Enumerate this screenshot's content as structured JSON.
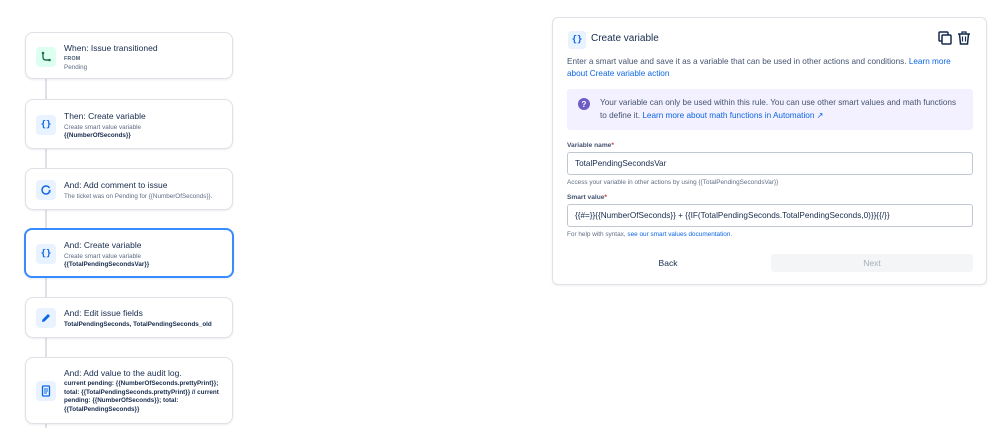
{
  "flow": {
    "cards": [
      {
        "title": "When: Issue transitioned",
        "sub_label": "FROM",
        "sub": "Pending",
        "icon": "branch-icon"
      },
      {
        "title": "Then: Create variable",
        "sub": "Create smart value variable",
        "detail": "{{NumberOfSeconds}}",
        "icon": "curly-braces-icon"
      },
      {
        "title": "And: Add comment to issue",
        "sub": "The ticket was on Pending for {{NumberOfSeconds}}.",
        "icon": "comment-arrow-icon"
      },
      {
        "title": "And: Create variable",
        "sub": "Create smart value variable",
        "detail": "{{TotalPendingSecondsVar}}",
        "icon": "curly-braces-icon"
      },
      {
        "title": "And: Edit issue fields",
        "detail": "TotalPendingSeconds, TotalPendingSeconds_old",
        "icon": "pencil-icon"
      },
      {
        "title": "And: Add value to the audit log.",
        "detail": "current pending: {{NumberOfSeconds.prettyPrint}}; total: {{TotalPendingSeconds.prettyPrint}} // current pending: {{NumberOfSeconds}}; total: {{TotalPendingSeconds}}",
        "icon": "document-icon"
      }
    ]
  },
  "panel": {
    "icon_glyph": "{}",
    "title": "Create variable",
    "description": "Enter a smart value and save it as a variable that can be used in other actions and conditions. ",
    "description_link": "Learn more about Create variable action",
    "info_text": "Your variable can only be used within this rule. You can use other smart values and math functions to define it. ",
    "info_link": "Learn more about math functions in Automation ↗",
    "info_icon_glyph": "?",
    "variable_name_label": "Variable name",
    "variable_name_value": "TotalPendingSecondsVar",
    "variable_name_helper": "Access your variable in other actions by using {{TotalPendingSecondsVar}}",
    "smart_value_label": "Smart value",
    "smart_value_value": "{{#=}}{{NumberOfSeconds}} + {{IF(TotalPendingSeconds.TotalPendingSeconds,0)}}{{/}}",
    "smart_value_helper": "For help with syntax, ",
    "smart_value_helper_link": "see our smart values documentation.",
    "required_marker": "*",
    "back_label": "Back",
    "next_label": "Next"
  },
  "colors": {
    "accent": "#0c66e4",
    "selected_border": "#388bff",
    "info_bg": "#f3f0ff",
    "info_icon": "#6e5dc6",
    "trigger_icon_bg": "#dcfff1"
  }
}
